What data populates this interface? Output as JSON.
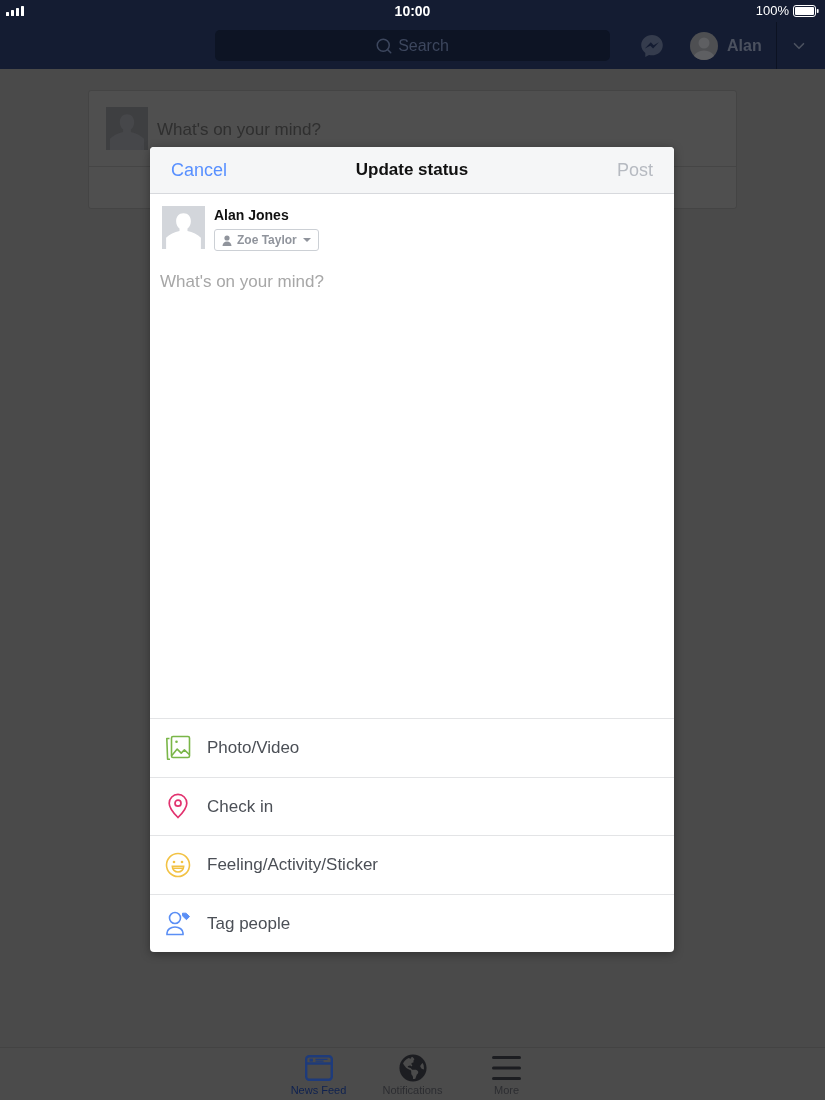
{
  "status_bar": {
    "time": "10:00",
    "battery": "100%"
  },
  "nav": {
    "search": {
      "placeholder": "Search"
    },
    "profile_name": "Alan"
  },
  "composer": {
    "placeholder": "What's on your mind?"
  },
  "dialog": {
    "cancel": "Cancel",
    "title": "Update status",
    "post": {
      "label": "Post",
      "disabled": true
    },
    "author": "Alan Jones",
    "audience": "Zoe Taylor",
    "input": {
      "placeholder": "What's on your mind?"
    },
    "actions": [
      {
        "kind": "photo",
        "label": "Photo/Video"
      },
      {
        "kind": "checkin",
        "label": "Check in"
      },
      {
        "kind": "feeling",
        "label": "Feeling/Activity/Sticker"
      },
      {
        "kind": "tag",
        "label": "Tag people"
      }
    ]
  },
  "tab_bar": [
    {
      "kind": "feed",
      "label": "News Feed",
      "selected": true
    },
    {
      "kind": "globe",
      "label": "Notifications",
      "selected": false
    },
    {
      "kind": "menu",
      "label": "More",
      "selected": false
    }
  ]
}
